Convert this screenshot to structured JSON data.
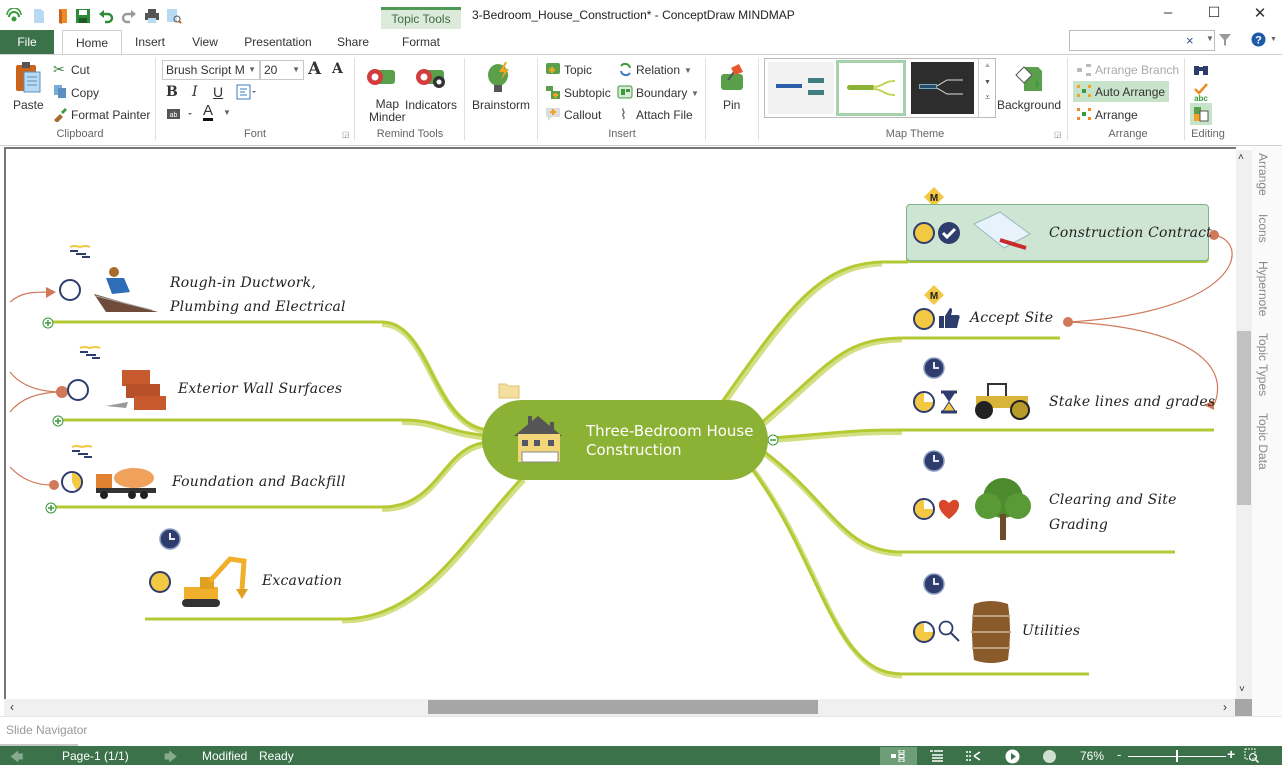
{
  "window": {
    "title": "3-Bedroom_House_Construction* - ConceptDraw MINDMAP",
    "context_tab": "Topic Tools",
    "controls": [
      "minimize",
      "maximize",
      "close"
    ]
  },
  "quick_access": [
    "app-logo-icon",
    "new-icon",
    "open-icon",
    "save-icon",
    "undo-icon",
    "redo-icon",
    "print-icon",
    "print-preview-icon"
  ],
  "tabs": {
    "file": "File",
    "items": [
      "Home",
      "Insert",
      "View",
      "Presentation",
      "Share",
      "Format"
    ],
    "active": "Home"
  },
  "search": {
    "value": "",
    "clear": "×"
  },
  "ribbon": {
    "clipboard": {
      "paste": "Paste",
      "cut": "Cut",
      "copy": "Copy",
      "format_painter": "Format Painter",
      "group": "Clipboard"
    },
    "font": {
      "family": "Brush Script M",
      "size": "20",
      "bold": "B",
      "italic": "I",
      "underline": "U",
      "color_letter": "A",
      "group": "Font",
      "grow": "A",
      "shrink": "A"
    },
    "remind": {
      "map_minder": "Map Minder",
      "map_minder_l1": "Map",
      "map_minder_l2": "Minder",
      "indicators": "Indicators",
      "group": "Remind Tools"
    },
    "brainstorm": {
      "label": "Brainstorm"
    },
    "insert": {
      "topic": "Topic",
      "subtopic": "Subtopic",
      "callout": "Callout",
      "relation": "Relation",
      "boundary": "Boundary",
      "attach_file": "Attach  File",
      "group": "Insert"
    },
    "pin": {
      "label": "Pin"
    },
    "map_theme": {
      "group": "Map Theme",
      "background": "Background",
      "selected_index": 1
    },
    "arrange": {
      "arrange_branch": "Arrange Branch",
      "auto_arrange": "Auto Arrange",
      "arrange": "Arrange",
      "group": "Arrange"
    },
    "editing": {
      "group": "Editing"
    }
  },
  "mindmap": {
    "central": {
      "line1": "Three-Bedroom House",
      "line2": "Construction"
    },
    "left_topics": [
      {
        "line1": "Rough-in Ductwork,",
        "line2": "Plumbing and Electrical",
        "icons": [
          "clock-empty-icon",
          "worker-image"
        ]
      },
      {
        "line1": "Exterior Wall Surfaces",
        "icons": [
          "clock-empty-icon",
          "bricks-image"
        ]
      },
      {
        "line1": "Foundation and Backfill",
        "icons": [
          "clock-quarter-icon",
          "concrete-mixer-image"
        ]
      },
      {
        "line1": "Excavation",
        "icons": [
          "clock-full-icon",
          "excavator-image"
        ]
      }
    ],
    "right_topics": [
      {
        "line1": "Construction Contract",
        "marker": "M",
        "icons": [
          "clock-full-icon",
          "checkmark-icon",
          "contract-image"
        ]
      },
      {
        "line1": "Accept Site",
        "marker": "M",
        "icons": [
          "clock-full-icon",
          "thumbs-up-icon"
        ]
      },
      {
        "line1": "Stake lines and grades",
        "icons": [
          "clock-three-quarter-icon",
          "hourglass-icon",
          "road-roller-image"
        ]
      },
      {
        "line1": "Clearing and Site",
        "line2": "Grading",
        "icons": [
          "clock-quarter-icon",
          "heart-icon",
          "tree-image"
        ]
      },
      {
        "line1": "Utilities",
        "icons": [
          "clock-three-quarter-icon",
          "magnifier-icon",
          "barrel-image"
        ]
      }
    ],
    "colors": {
      "branch": "#b5c934",
      "central": "#8bb135",
      "relation": "#d0785a",
      "clock": "#2e3d6e",
      "clock_fill": "#f3c842"
    }
  },
  "side_tabs": [
    "Arrange",
    "Icons",
    "Hypernote",
    "Topic Types",
    "Topic Data"
  ],
  "slide_navigator": "Slide Navigator",
  "status": {
    "page": "Page-1 (1/1)",
    "modified": "Modified",
    "ready": "Ready",
    "zoom": "76%",
    "zoom_slider_fraction": 0.5
  }
}
